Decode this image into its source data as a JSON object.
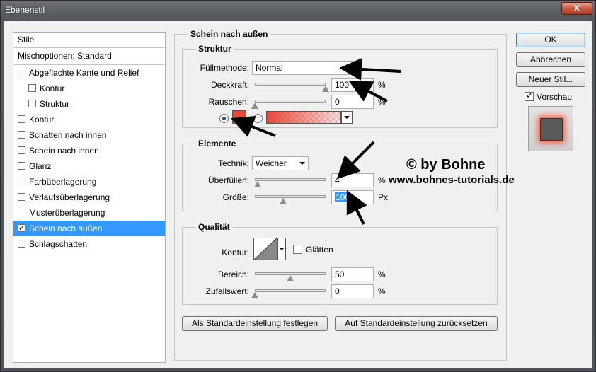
{
  "window": {
    "title": "Ebenenstil",
    "close_symbol": "X"
  },
  "style_list": {
    "header": "Stile",
    "blending": "Mischoptionen: Standard",
    "items": [
      {
        "label": "Abgeflachte Kante und Relief",
        "checked": false,
        "sub": false
      },
      {
        "label": "Kontur",
        "checked": false,
        "sub": true
      },
      {
        "label": "Struktur",
        "checked": false,
        "sub": true
      },
      {
        "label": "Kontur",
        "checked": false,
        "sub": false
      },
      {
        "label": "Schatten nach innen",
        "checked": false,
        "sub": false
      },
      {
        "label": "Schein nach innen",
        "checked": false,
        "sub": false
      },
      {
        "label": "Glanz",
        "checked": false,
        "sub": false
      },
      {
        "label": "Farbüberlagerung",
        "checked": false,
        "sub": false
      },
      {
        "label": "Verlaufsüberlagerung",
        "checked": false,
        "sub": false
      },
      {
        "label": "Musterüberlagerung",
        "checked": false,
        "sub": false
      },
      {
        "label": "Schein nach außen",
        "checked": true,
        "sub": false,
        "selected": true
      },
      {
        "label": "Schlagschatten",
        "checked": false,
        "sub": false
      }
    ]
  },
  "panel": {
    "title": "Schein nach außen",
    "struktur": {
      "title": "Struktur",
      "fill_method_label": "Füllmethode:",
      "fill_method_value": "Normal",
      "opacity_label": "Deckkraft:",
      "opacity_value": "100",
      "opacity_unit": "%",
      "opacity_level": 1.0,
      "noise_label": "Rauschen:",
      "noise_value": "0",
      "noise_unit": "%",
      "noise_level": 0.0,
      "swatch_color": "#e8473a"
    },
    "elemente": {
      "title": "Elemente",
      "technique_label": "Technik:",
      "technique_value": "Weicher",
      "spread_label": "Überfüllen:",
      "spread_value": "4",
      "spread_unit": "%",
      "spread_level": 0.04,
      "size_label": "Größe:",
      "size_value": "100",
      "size_unit": "Px",
      "size_level": 0.4
    },
    "qualitaet": {
      "title": "Qualität",
      "contour_label": "Kontur:",
      "antialias_label": "Glätten",
      "range_label": "Bereich:",
      "range_value": "50",
      "range_unit": "%",
      "range_level": 0.5,
      "jitter_label": "Zufallswert:",
      "jitter_value": "0",
      "jitter_unit": "%",
      "jitter_level": 0.0
    },
    "set_default_label": "Als Standardeinstellung festlegen",
    "reset_default_label": "Auf Standardeinstellung zurücksetzen"
  },
  "buttons": {
    "ok": "OK",
    "cancel": "Abbrechen",
    "new_style": "Neuer Stil...",
    "preview_label": "Vorschau"
  },
  "watermark": {
    "line1": "© by Bohne",
    "line2": "www.bohnes-tutorials.de"
  },
  "colors": {
    "selection": "#3399ff",
    "glow": "#ff5a3c",
    "preview_fill": "#5a5a5a"
  }
}
